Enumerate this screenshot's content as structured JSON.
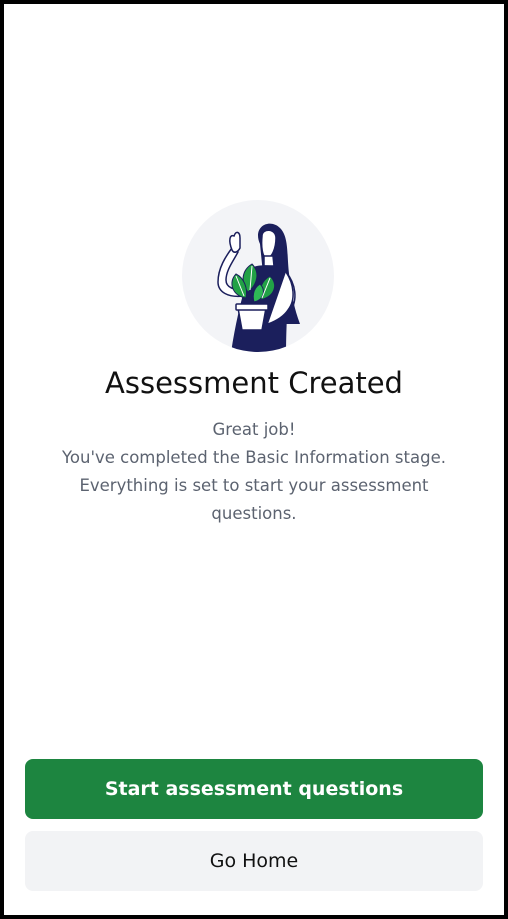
{
  "screen": {
    "title": "Assessment Created",
    "message_lines": [
      "Great job!",
      "You've completed the Basic Information stage.",
      "Everything is set to start your assessment",
      "questions."
    ]
  },
  "actions": {
    "primary_label": "Start assessment questions",
    "secondary_label": "Go Home"
  },
  "colors": {
    "primary": "#1d8540",
    "secondary_bg": "#f2f3f5",
    "illustration_bg": "#f3f4f7",
    "figure_navy": "#1b1f5c",
    "plant_green": "#22a146"
  },
  "icons": {
    "illustration": "woman-holding-plant-illustration"
  }
}
